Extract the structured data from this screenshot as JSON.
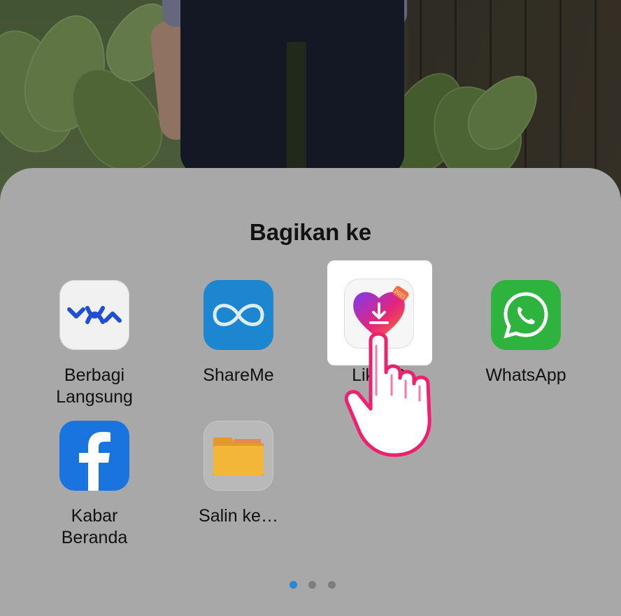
{
  "share_sheet": {
    "title": "Bagikan ke",
    "apps": [
      {
        "label": "Berbagi\nLangsung",
        "icon": "nearby-share-icon"
      },
      {
        "label": "ShareMe",
        "icon": "shareme-infinity-icon"
      },
      {
        "label": "LikeeD",
        "icon": "heart-download-icon",
        "badge": "2021",
        "highlighted": true
      },
      {
        "label": "WhatsApp",
        "icon": "whatsapp-phone-icon"
      },
      {
        "label": "Kabar\nBeranda",
        "icon": "facebook-icon"
      },
      {
        "label": "Salin ke…",
        "icon": "folder-icon"
      }
    ],
    "page_indicator": {
      "count": 3,
      "active_index": 0
    }
  },
  "colors": {
    "sheet_bg": "#a8a8a8",
    "active_dot": "#2b86d6",
    "hand_stroke": "#f0206e",
    "shareme_blue": "#1d86d1",
    "whatsapp_green": "#2fb33f",
    "facebook_blue": "#1974e0",
    "folder_orange": "#e3a32b"
  }
}
